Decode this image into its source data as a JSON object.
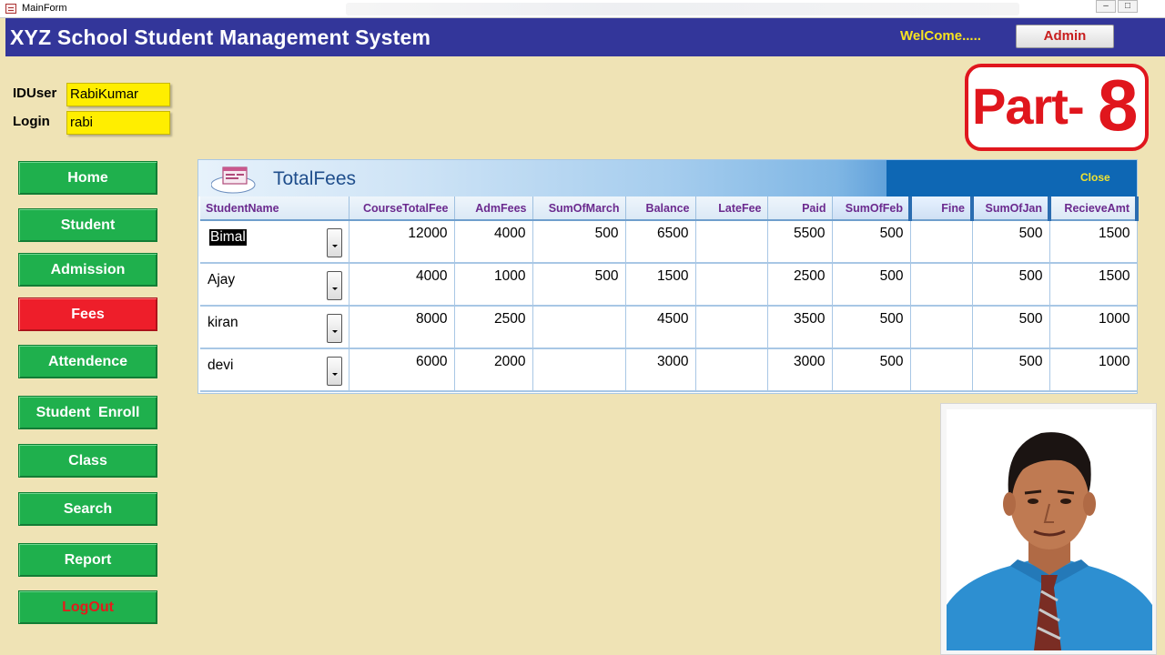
{
  "window": {
    "title": "MainForm"
  },
  "header": {
    "app_title": "XYZ School Student Management System",
    "welcome": "WelCome.....",
    "user_button": "Admin"
  },
  "user_info": {
    "iduser_label": "IDUser",
    "iduser_value": "RabiKumar",
    "login_label": "Login",
    "login_value": "rabi"
  },
  "badge": {
    "text": "Part-",
    "number": "8"
  },
  "nav": {
    "home": "Home",
    "student": "Student",
    "admission": "Admission",
    "fees": "Fees",
    "attendence": "Attendence",
    "student_enroll": "Student  Enroll",
    "class": "Class",
    "search": "Search",
    "report": "Report",
    "logout": "LogOut"
  },
  "subform": {
    "title": "TotalFees",
    "close_label": "Close",
    "columns": [
      "StudentName",
      "CourseTotalFee",
      "AdmFees",
      "SumOfMarch",
      "Balance",
      "LateFee",
      "Paid",
      "SumOfFeb",
      "Fine",
      "SumOfJan",
      "RecieveAmt"
    ],
    "rows": [
      [
        "Bimal",
        "12000",
        "4000",
        "500",
        "6500",
        "",
        "5500",
        "500",
        "",
        "500",
        "1500"
      ],
      [
        "Ajay",
        "4000",
        "1000",
        "500",
        "1500",
        "",
        "2500",
        "500",
        "",
        "500",
        "1500"
      ],
      [
        "kiran",
        "8000",
        "2500",
        "",
        "4500",
        "",
        "3500",
        "500",
        "",
        "500",
        "1000"
      ],
      [
        "devi",
        "6000",
        "2000",
        "",
        "3000",
        "",
        "3000",
        "500",
        "",
        "500",
        "1000"
      ]
    ]
  },
  "colors": {
    "background": "#efe3b5",
    "header": "#33369a",
    "nav_green": "#1fb04d",
    "nav_active_red": "#ee1e2a",
    "field_yellow": "#ffee00",
    "column_header_text": "#6b2a8e"
  }
}
